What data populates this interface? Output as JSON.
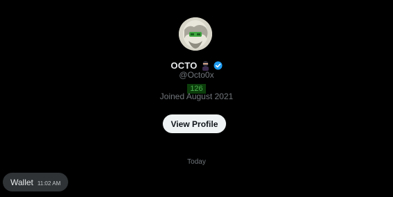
{
  "profile": {
    "display_name": "OCTO",
    "name_emoji_icon": "ninja-emoji-icon",
    "verified_icon": "verified-check-icon",
    "handle": "@Octo0x",
    "count_badge": "126",
    "joined": "Joined August 2021",
    "view_profile_label": "View Profile"
  },
  "conversation": {
    "date_divider": "Today",
    "messages": [
      {
        "text": "Wallet",
        "time": "11:02 AM"
      }
    ]
  },
  "colors": {
    "background": "#000000",
    "verified_blue": "#1d9bf0",
    "badge_bg": "#0b3d0b",
    "badge_text": "#4caf50",
    "bubble_bg": "#2f3336",
    "button_bg": "#eff3f4"
  }
}
